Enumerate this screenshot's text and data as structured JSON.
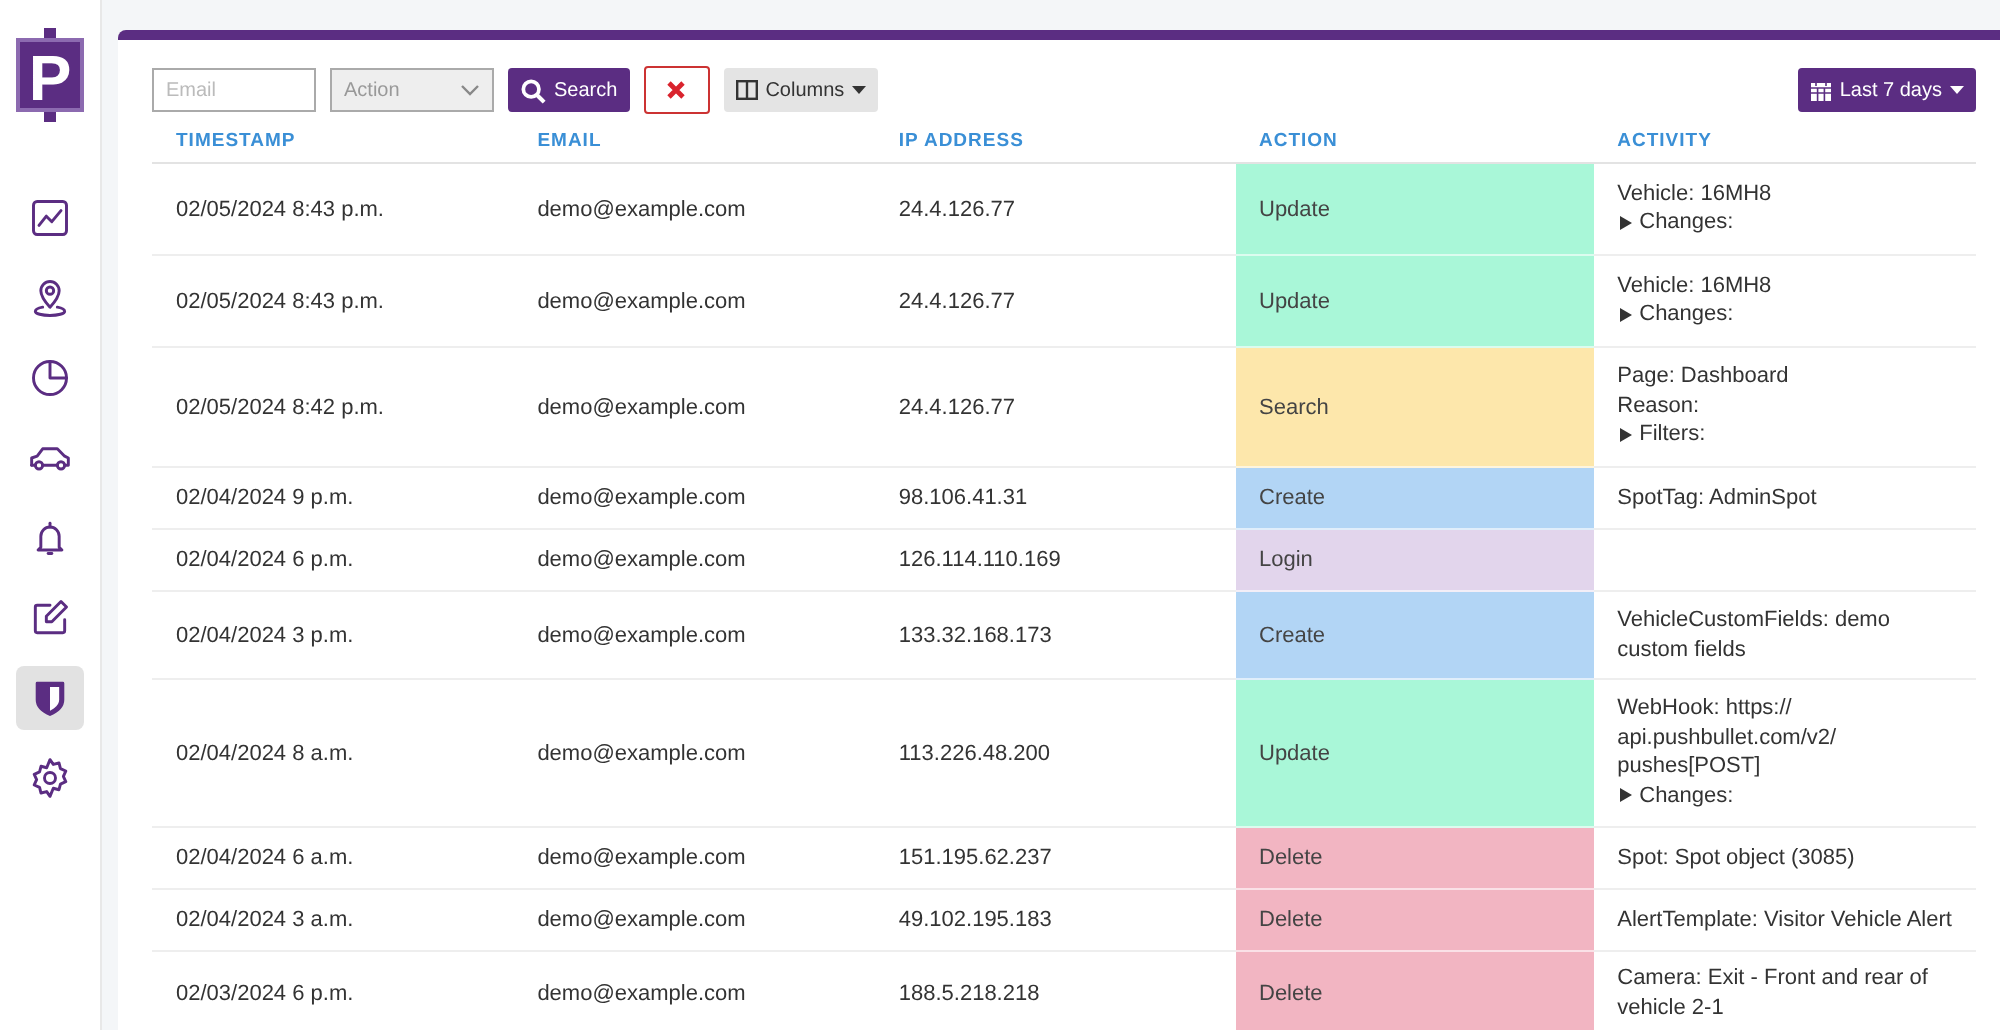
{
  "sidebar": {
    "items": [
      {
        "kind": "chart",
        "selected": false
      },
      {
        "kind": "pin",
        "selected": false
      },
      {
        "kind": "pie",
        "selected": false
      },
      {
        "kind": "car",
        "selected": false
      },
      {
        "kind": "bell",
        "selected": false
      },
      {
        "kind": "edit",
        "selected": false
      },
      {
        "kind": "shield",
        "selected": true
      },
      {
        "kind": "gear",
        "selected": false
      }
    ]
  },
  "logo": {
    "letter": "P"
  },
  "toolbar": {
    "email": {
      "placeholder": "Email"
    },
    "action": {
      "placeholder": "Action"
    },
    "search_button": "Search",
    "columns_button": "Columns",
    "date_range": "Last 7 days"
  },
  "table": {
    "columns": [
      "TIMESTAMP",
      "EMAIL",
      "IP ADDRESS",
      "ACTION",
      "ACTIVITY"
    ],
    "rows": [
      {
        "timestamp": "02/05/2024 8:43 p.m.",
        "email": "demo@example.com",
        "ip": "24.4.126.77",
        "action": "Update",
        "color": "#a9f7d8",
        "activity": [
          {
            "kind": "text",
            "text": "Vehicle: 16MH8"
          },
          {
            "kind": "expander",
            "text": "Changes:"
          }
        ]
      },
      {
        "timestamp": "02/05/2024 8:43 p.m.",
        "email": "demo@example.com",
        "ip": "24.4.126.77",
        "action": "Update",
        "color": "#a9f7d8",
        "activity": [
          {
            "kind": "text",
            "text": "Vehicle: 16MH8"
          },
          {
            "kind": "expander",
            "text": "Changes:"
          }
        ]
      },
      {
        "timestamp": "02/05/2024 8:42 p.m.",
        "email": "demo@example.com",
        "ip": "24.4.126.77",
        "action": "Search",
        "color": "#fde7ab",
        "activity": [
          {
            "kind": "text",
            "text": "Page: Dashboard"
          },
          {
            "kind": "text",
            "text": "Reason:"
          },
          {
            "kind": "expander",
            "text": "Filters:"
          }
        ]
      },
      {
        "timestamp": "02/04/2024 9 p.m.",
        "email": "demo@example.com",
        "ip": "98.106.41.31",
        "action": "Create",
        "color": "#b2d5f5",
        "activity": [
          {
            "kind": "text",
            "text": "SpotTag: AdminSpot"
          }
        ]
      },
      {
        "timestamp": "02/04/2024 6 p.m.",
        "email": "demo@example.com",
        "ip": "126.114.110.169",
        "action": "Login",
        "color": "#e2d5ec",
        "activity": []
      },
      {
        "timestamp": "02/04/2024 3 p.m.",
        "email": "demo@example.com",
        "ip": "133.32.168.173",
        "action": "Create",
        "color": "#b2d5f5",
        "activity": [
          {
            "kind": "text",
            "text": "VehicleCustomFields: demo"
          },
          {
            "kind": "text",
            "text": "custom fields"
          }
        ]
      },
      {
        "timestamp": "02/04/2024 8 a.m.",
        "email": "demo@example.com",
        "ip": "113.226.48.200",
        "action": "Update",
        "color": "#a9f7d8",
        "activity": [
          {
            "kind": "text",
            "text": "WebHook: https://"
          },
          {
            "kind": "text",
            "text": "api.pushbullet.com/v2/"
          },
          {
            "kind": "text",
            "text": "pushes[POST]"
          },
          {
            "kind": "expander",
            "text": "Changes:"
          }
        ]
      },
      {
        "timestamp": "02/04/2024 6 a.m.",
        "email": "demo@example.com",
        "ip": "151.195.62.237",
        "action": "Delete",
        "color": "#f2b5c2",
        "activity": [
          {
            "kind": "text",
            "text": "Spot: Spot object (3085)"
          }
        ]
      },
      {
        "timestamp": "02/04/2024 3 a.m.",
        "email": "demo@example.com",
        "ip": "49.102.195.183",
        "action": "Delete",
        "color": "#f2b5c2",
        "activity": [
          {
            "kind": "text",
            "text": "AlertTemplate: Visitor Vehicle Alert"
          }
        ]
      },
      {
        "timestamp": "02/03/2024 6 p.m.",
        "email": "demo@example.com",
        "ip": "188.5.218.218",
        "action": "Delete",
        "color": "#f2b5c2",
        "activity": [
          {
            "kind": "text",
            "text": "Camera: Exit - Front and rear of"
          },
          {
            "kind": "text",
            "text": "vehicle 2-1"
          }
        ]
      }
    ]
  }
}
